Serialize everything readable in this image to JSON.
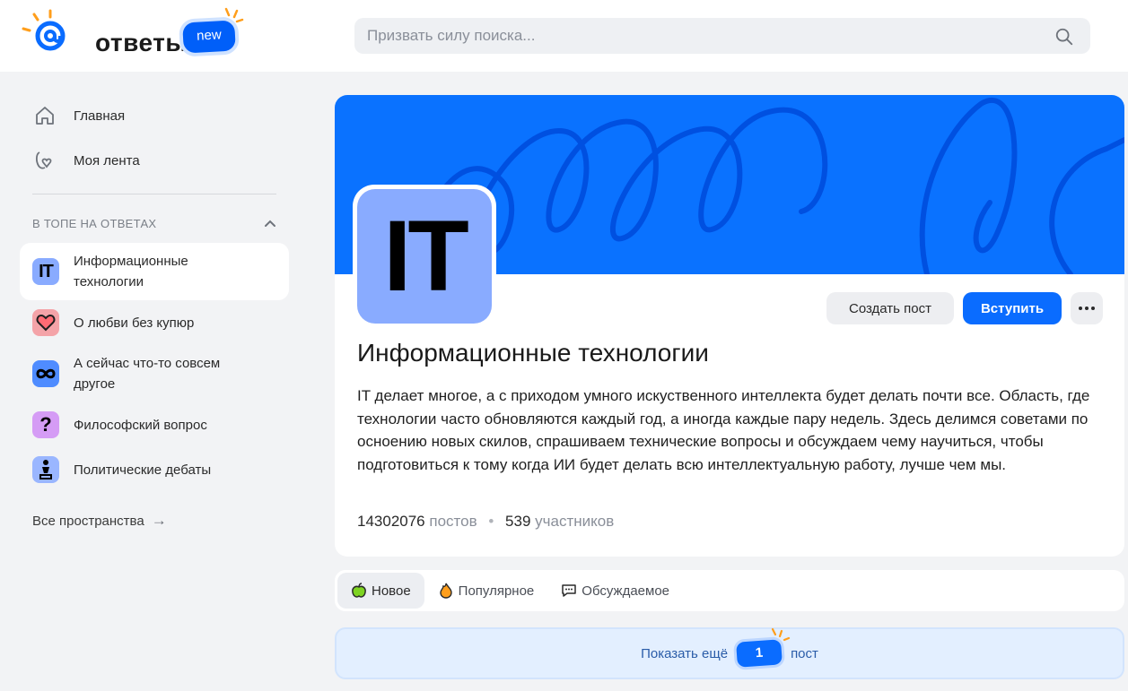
{
  "header": {
    "logo_text": "ответы",
    "new_badge": "new",
    "search_placeholder": "Призвать силу поиска..."
  },
  "sidebar": {
    "nav": [
      {
        "label": "Главная",
        "icon": "home-icon"
      },
      {
        "label": "Моя лента",
        "icon": "feed-heart-icon"
      }
    ],
    "section_title": "В ТОПЕ НА ОТВЕТАХ",
    "topics": [
      {
        "label": "Информационные технологии",
        "icon": "it-icon",
        "icon_text": "IT",
        "color": "#89abff",
        "active": true
      },
      {
        "label": "О любви без купюр",
        "icon": "heart-icon",
        "color": "#f4a3a8"
      },
      {
        "label": "А сейчас что-то совсем другое",
        "icon": "infinity-icon",
        "color": "#4f8cff"
      },
      {
        "label": "Философский вопрос",
        "icon": "question-icon",
        "icon_text": "?",
        "color": "#d59cf5"
      },
      {
        "label": "Политические дебаты",
        "icon": "podium-icon",
        "color": "#9ab6ff"
      }
    ],
    "all_spaces": "Все пространства",
    "all_spaces_arrow": "→"
  },
  "space": {
    "avatar_text": "IT",
    "title": "Информационные технологии",
    "description": "IT делает многое, а с приходом умного искуственного интеллекта будет делать почти все. Область, где технологии часто обновляются каждый год, а иногда каждые пару недель. Здесь делимся советами по осноению новых скилов, спрашиваем технические вопросы и обсуждаем чему научиться, чтобы подготовиться к тому когда ИИ будет делать всю интеллектуальную работу, лучше чем мы.",
    "posts_count": "14302076",
    "posts_label": "постов",
    "members_count": "539",
    "members_label": "участников",
    "create_post_label": "Создать пост",
    "join_label": "Вступить",
    "more_label": "•••"
  },
  "tabs": [
    {
      "label": "Новое",
      "icon": "apple-icon",
      "active": true
    },
    {
      "label": "Популярное",
      "icon": "fire-icon"
    },
    {
      "label": "Обсуждаемое",
      "icon": "chat-icon"
    }
  ],
  "show_more": {
    "prefix": "Показать ещё",
    "count": "1",
    "suffix": "пост"
  },
  "colors": {
    "accent": "#0a6cff",
    "banner": "#0a72ff",
    "background": "#f2f3f5"
  }
}
